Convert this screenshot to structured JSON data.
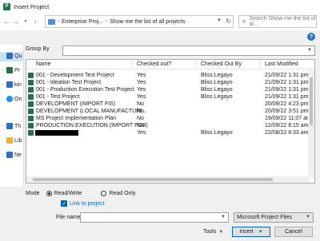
{
  "window": {
    "title": "Insert Project",
    "app_icon_letter": "P"
  },
  "address": {
    "crumbs": [
      "Enterprise Proj...",
      "Show me the list of all projects"
    ],
    "search_placeholder": "Search Show me the list of al..."
  },
  "nav": {
    "items": [
      {
        "label": "Qu",
        "color": "#2b6fc6"
      },
      {
        "label": "Pr",
        "color": "#217346"
      },
      {
        "label": "kin",
        "color": "#2b6fc6"
      },
      {
        "label": "On",
        "color": "#1e90ff"
      },
      {
        "label": "Th",
        "color": "#2b6fc6"
      },
      {
        "label": "Lib",
        "color": "#e8b33a"
      },
      {
        "label": "Ne",
        "color": "#2b6fc6"
      }
    ]
  },
  "groupby": {
    "label": "Group By",
    "value": ""
  },
  "list": {
    "columns": [
      "Name",
      "Checked out?",
      "Checked Out By",
      "Last Modified"
    ],
    "rows": [
      {
        "name": "001 - Development Test Project",
        "checked_out": "Yes",
        "by": "Bliss Legayo",
        "modified": "21/09/22 1:31 pm"
      },
      {
        "name": "001 - Ideation Test Project",
        "checked_out": "Yes",
        "by": "Bliss Legayo",
        "modified": "21/09/22 1:31 pm"
      },
      {
        "name": "001 - Production Execution Test Project",
        "checked_out": "Yes",
        "by": "Bliss Legayo",
        "modified": "21/09/22 1:31 pm"
      },
      {
        "name": "001 - Test Project",
        "checked_out": "Yes",
        "by": "Bliss Legayo",
        "modified": "21/09/22 1:31 pm"
      },
      {
        "name": "DEVELOPMENT (IMPORT FIS)",
        "checked_out": "No",
        "by": "",
        "modified": "20/09/22 4:23 pm"
      },
      {
        "name": "DEVELOPMENT (LOCAL MANUFACTURI...",
        "checked_out": "No",
        "by": "",
        "modified": "20/09/22 3:51 pm"
      },
      {
        "name": "MS Project Implementation Plan",
        "checked_out": "No",
        "by": "",
        "modified": "19/09/22 11:07 am"
      },
      {
        "name": "PRODUCTION EXECUTION (IMPORT FOB)",
        "checked_out": "No",
        "by": "",
        "modified": "12/09/22 8:15 am"
      },
      {
        "name": "",
        "checked_out": "Yes",
        "by": "Bliss Legayo",
        "modified": "22/08/22 8:33 am",
        "redacted": true
      }
    ]
  },
  "mode": {
    "label": "Mode",
    "options": [
      "Read/Write",
      "Read Only"
    ],
    "selected": "Read/Write"
  },
  "link_to_project": {
    "label": "Link to project",
    "checked": true
  },
  "filename": {
    "label": "File name:",
    "value": ""
  },
  "filetype": {
    "value": "Microsoft Project Files"
  },
  "buttons": {
    "tools": "Tools",
    "insert": "Insert",
    "cancel": "Cancel"
  }
}
